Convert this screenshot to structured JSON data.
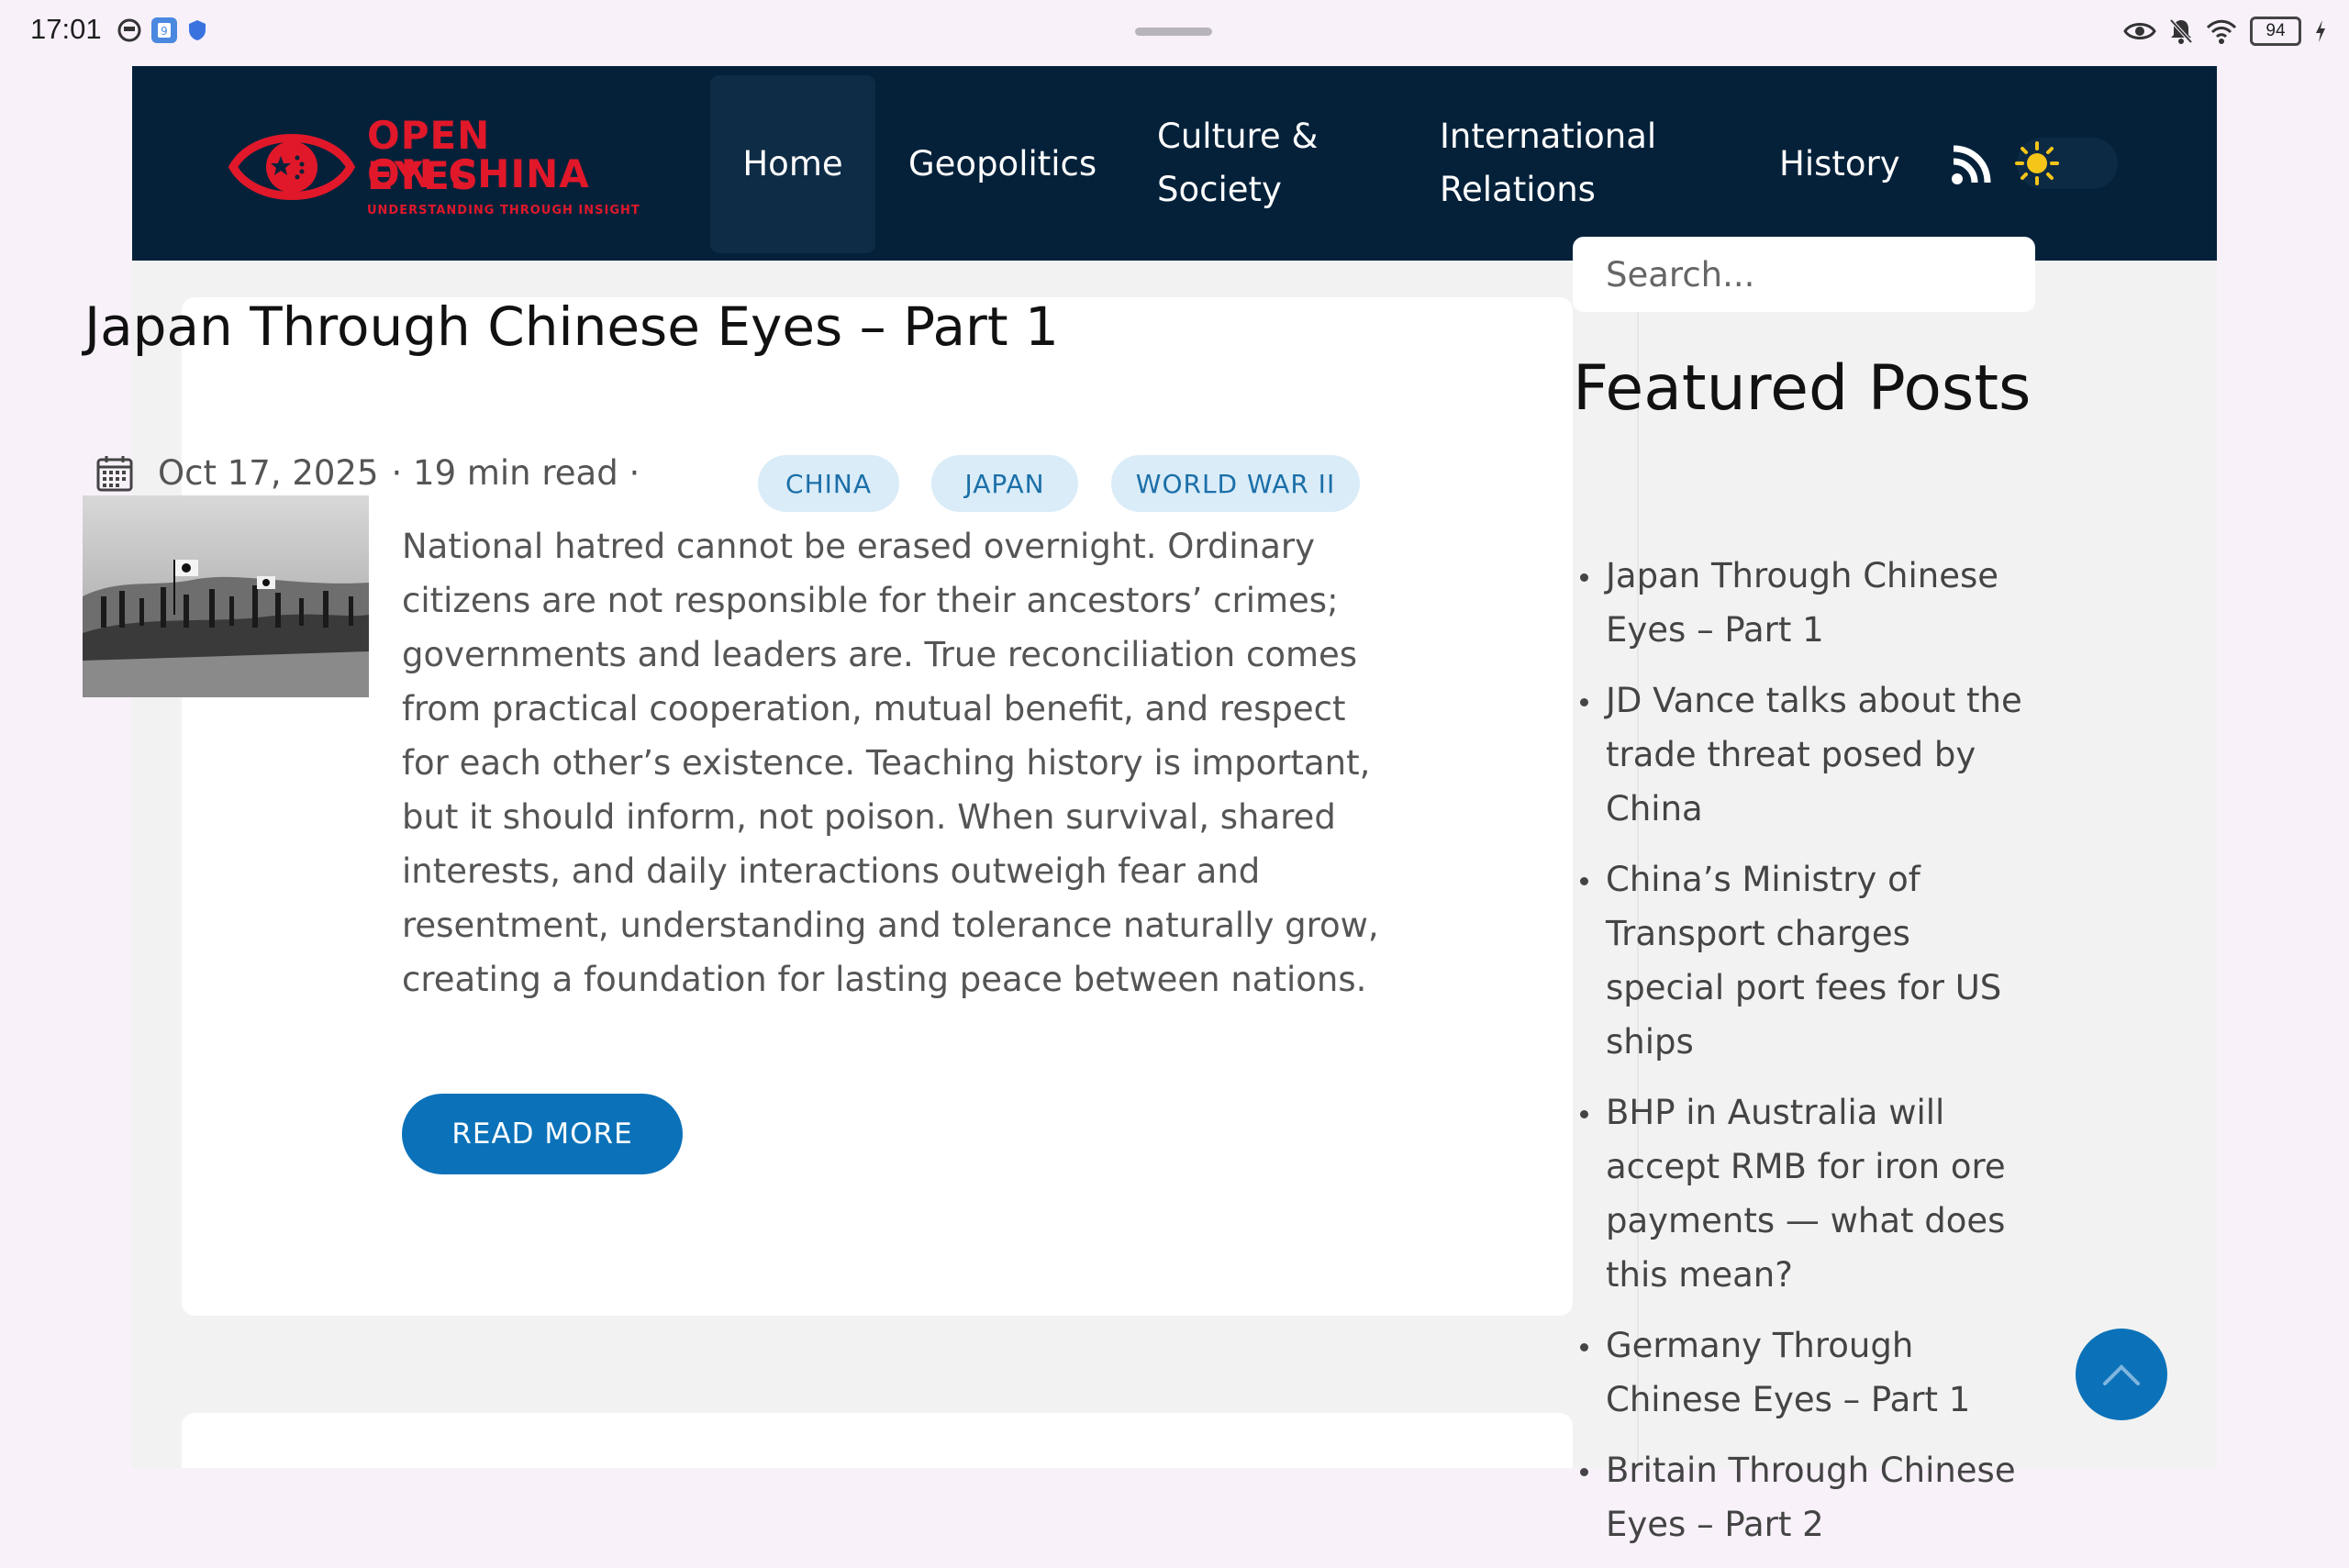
{
  "status_bar": {
    "time": "17:01",
    "battery": "94"
  },
  "site": {
    "logo": {
      "line1": "OPEN EYES",
      "line2": "ON CHINA",
      "tagline": "UNDERSTANDING THROUGH INSIGHT"
    },
    "nav": {
      "home": "Home",
      "geopolitics": "Geopolitics",
      "culture_line1": "Culture &",
      "culture_line2": "Society",
      "intl_line1": "International",
      "intl_line2": "Relations",
      "history": "History"
    }
  },
  "post": {
    "title": "Japan Through Chinese Eyes – Part 1",
    "date": "Oct 17, 2025",
    "read_time": "· 19 min read ·",
    "tags": [
      "CHINA",
      "JAPAN",
      "WORLD WAR II"
    ],
    "excerpt": "National hatred cannot be erased overnight. Ordinary citizens are not responsible for their ancestors’ crimes; governments and leaders are. True reconciliation comes from practical cooperation, mutual benefit, and respect for each other’s existence. Teaching history is important, but it should inform, not poison. When survival, shared interests, and daily interactions outweigh fear and resentment, understanding and tolerance naturally grow, creating a foundation for lasting peace between nations.",
    "read_more": "READ MORE"
  },
  "sidebar": {
    "search_placeholder": "Search...",
    "featured_title": "Featured Posts",
    "featured_posts": [
      "Japan Through Chinese Eyes – Part 1",
      "JD Vance talks about the trade threat posed by China",
      "China’s Ministry of Transport charges special port fees for US ships",
      "BHP in Australia will accept RMB for iron ore payments — what does this mean?",
      "Germany Through Chinese Eyes – Part 1",
      "Britain Through Chinese Eyes – Part 2"
    ]
  },
  "colors": {
    "navbar": "#05213a",
    "brand_red": "#e0182a",
    "accent_blue": "#0b72b9",
    "tag_bg": "#d9ecf8"
  },
  "icons": [
    "calendar-icon",
    "rss-icon",
    "sun-icon",
    "arrow-up-icon",
    "eye-icon",
    "bell-off-icon",
    "wifi-icon",
    "battery-icon",
    "charging-icon"
  ]
}
